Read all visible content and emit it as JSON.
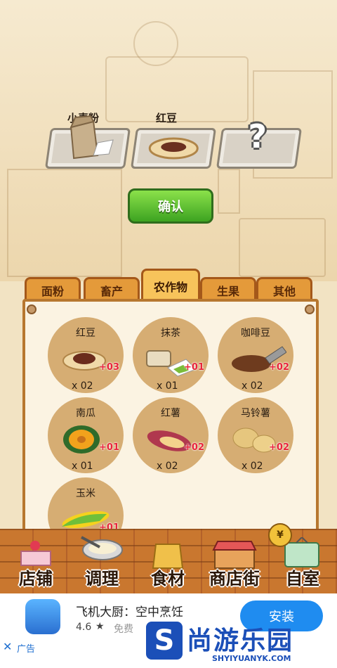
{
  "slots": [
    {
      "label": "小麦粉",
      "icon": "flour-bag-icon"
    },
    {
      "label": "红豆",
      "icon": "red-bean-plate-icon"
    },
    {
      "label": "",
      "icon": "question-mark-icon"
    }
  ],
  "confirm_label": "确认",
  "tabs": [
    "面粉",
    "畜产",
    "农作物",
    "生果",
    "其他"
  ],
  "active_tab": "农作物",
  "items": [
    {
      "name": "红豆",
      "bonus": "+03",
      "qty": "x 02",
      "icon": "red-bean-icon"
    },
    {
      "name": "抹茶",
      "bonus": "+01",
      "qty": "x 01",
      "icon": "matcha-icon"
    },
    {
      "name": "咖啡豆",
      "bonus": "+02",
      "qty": "x 02",
      "icon": "coffee-bean-icon"
    },
    {
      "name": "南瓜",
      "bonus": "+01",
      "qty": "x 01",
      "icon": "pumpkin-icon"
    },
    {
      "name": "红薯",
      "bonus": "+02",
      "qty": "x 02",
      "icon": "sweet-potato-icon"
    },
    {
      "name": "马铃薯",
      "bonus": "+02",
      "qty": "x 02",
      "icon": "potato-icon"
    },
    {
      "name": "玉米",
      "bonus": "+01",
      "qty": "",
      "icon": "corn-icon"
    }
  ],
  "nav": [
    {
      "label": "店铺",
      "icon": "cake-icon"
    },
    {
      "label": "调理",
      "icon": "mixing-bowl-icon"
    },
    {
      "label": "食材",
      "icon": "ingredient-bag-icon"
    },
    {
      "label": "商店街",
      "icon": "shop-street-icon"
    },
    {
      "label": "自室",
      "icon": "staff-only-sign-icon"
    }
  ],
  "ad": {
    "app_name": "飞机大厨：空中烹饪",
    "rating": "4.6",
    "price": "免费",
    "install_label": "安装",
    "ad_tag": "广告",
    "close": "✕"
  },
  "watermark": {
    "text": "尚游乐园",
    "url": "SHYIYUANYK.COM"
  },
  "colors": {
    "accent_green": "#3da321",
    "tab_orange": "#e49a3a",
    "bonus_red": "#e8253a",
    "install_blue": "#1f8cf0"
  }
}
